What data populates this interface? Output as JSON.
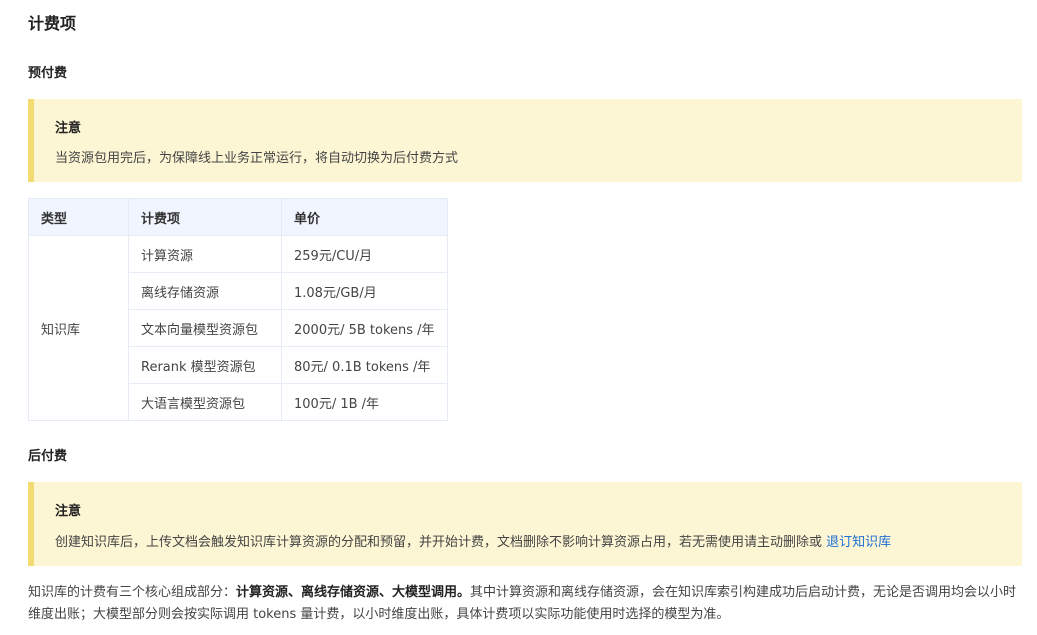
{
  "title": "计费项",
  "prepaid": {
    "heading": "预付费",
    "notice": {
      "title": "注意",
      "body": "当资源包用完后，为保障线上业务正常运行，将自动切换为后付费方式"
    },
    "table": {
      "headers": [
        "类型",
        "计费项",
        "单价"
      ],
      "type": "知识库",
      "rows": [
        {
          "item": "计算资源",
          "price": "259元/CU/月"
        },
        {
          "item": "离线存储资源",
          "price": "1.08元/GB/月"
        },
        {
          "item": "文本向量模型资源包",
          "price": "2000元/ 5B tokens /年"
        },
        {
          "item": "Rerank 模型资源包",
          "price": "80元/ 0.1B tokens /年"
        },
        {
          "item": "大语言模型资源包",
          "price": "100元/ 1B /年"
        }
      ]
    }
  },
  "postpaid": {
    "heading": "后付费",
    "notice": {
      "title": "注意",
      "body": "创建知识库后，上传文档会触发知识库计算资源的分配和预留，并开始计费，文档删除不影响计算资源占用，若无需使用请主动删除或 ",
      "link": "退订知识库"
    }
  },
  "paragraph": {
    "intro": "知识库的计费有三个核心组成部分：",
    "bold": "计算资源、离线存储资源、大模型调用。",
    "rest": "其中计算资源和离线存储资源，会在知识库索引构建成功后启动计费，无论是否调用均会以小时维度出账；大模型部分则会按实际调用 tokens 量计费，以小时维度出账，具体计费项以实际功能使用时选择的模型为准。"
  }
}
